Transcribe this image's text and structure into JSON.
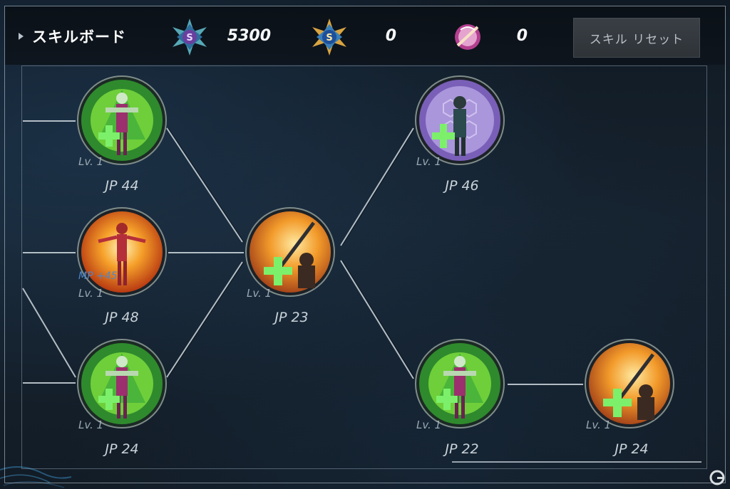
{
  "header": {
    "title": "スキルボード",
    "currencies": [
      {
        "icon": "blue-sp-crystal-icon",
        "value": "5300"
      },
      {
        "icon": "gold-sp-crystal-icon",
        "value": "0"
      },
      {
        "icon": "pink-orb-icon",
        "value": "0"
      }
    ],
    "reset_label": "スキル リセット"
  },
  "nodes": [
    {
      "id": "a",
      "icon": "green-heal-icon",
      "level": "Lv. 1",
      "jp": "JP 44"
    },
    {
      "id": "b",
      "icon": "orange-body-icon",
      "level": "Lv. 1",
      "jp": "JP 48",
      "mp": "MP +45"
    },
    {
      "id": "c",
      "icon": "green-heal-icon",
      "level": "Lv. 1",
      "jp": "JP 24"
    },
    {
      "id": "d",
      "icon": "sword-plus-icon",
      "level": "Lv. 1",
      "jp": "JP 23"
    },
    {
      "id": "e",
      "icon": "purple-shield-icon",
      "level": "Lv. 1",
      "jp": "JP 46"
    },
    {
      "id": "f",
      "icon": "green-heal-icon",
      "level": "Lv. 1",
      "jp": "JP 22"
    },
    {
      "id": "g",
      "icon": "sword-plus-icon",
      "level": "Lv. 1",
      "jp": "JP 24"
    }
  ]
}
